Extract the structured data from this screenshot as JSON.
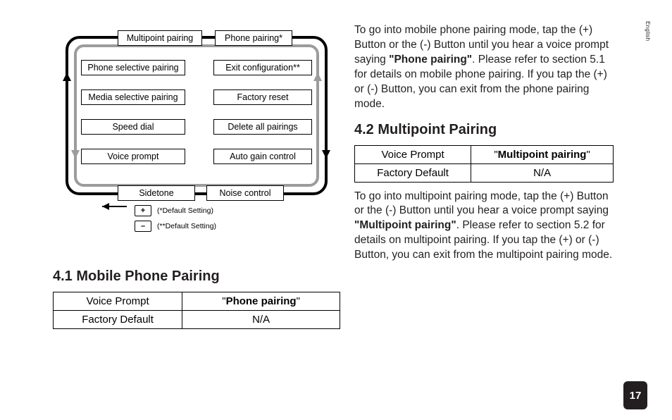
{
  "sideTab": "English",
  "diagram": {
    "top": {
      "left": "Multipoint pairing",
      "right": "Phone pairing*"
    },
    "leftCol": [
      "Phone selective pairing",
      "Media selective pairing",
      "Speed dial",
      "Voice prompt"
    ],
    "rightCol": [
      "Exit configuration**",
      "Factory reset",
      "Delete all pairings",
      "Auto gain control"
    ],
    "bottom": {
      "left": "Sidetone",
      "right": "Noise control"
    },
    "legend": {
      "plus": {
        "symbol": "+",
        "text": "(*Default Setting)"
      },
      "minus": {
        "symbol": "–",
        "text": "(**Default Setting)"
      }
    }
  },
  "section41": {
    "heading": "4.1 Mobile Phone Pairing",
    "table": {
      "row1": {
        "label": "Voice Prompt",
        "q1": "\"",
        "bold": "Phone pairing",
        "q2": "\""
      },
      "row2": {
        "label": "Factory Default",
        "value": "N/A"
      }
    }
  },
  "section41b": {
    "p_a": "To go into mobile phone pairing mode, tap the (+) Button or the (-) Button until you hear a voice prompt saying ",
    "p_bold": "\"Phone pairing\"",
    "p_b": ". Please refer to section 5.1 for details on mobile phone pairing. If you tap the (+) or (-) Button, you can exit from the phone pairing mode."
  },
  "section42": {
    "heading": "4.2 Multipoint Pairing",
    "table": {
      "row1": {
        "label": "Voice Prompt",
        "q1": "\"",
        "bold": "Multipoint pairing",
        "q2": "\""
      },
      "row2": {
        "label": "Factory Default",
        "value": "N/A"
      }
    },
    "p_a": "To go into multipoint pairing mode, tap the (+) Button or the (-) Button until you hear a voice prompt saying ",
    "p_bold": "\"Multipoint pairing\"",
    "p_b": ". Please refer to section 5.2 for details on multipoint pairing. If you tap the (+) or (-) Button, you can exit from the multipoint pairing mode."
  },
  "pageNumber": "17"
}
